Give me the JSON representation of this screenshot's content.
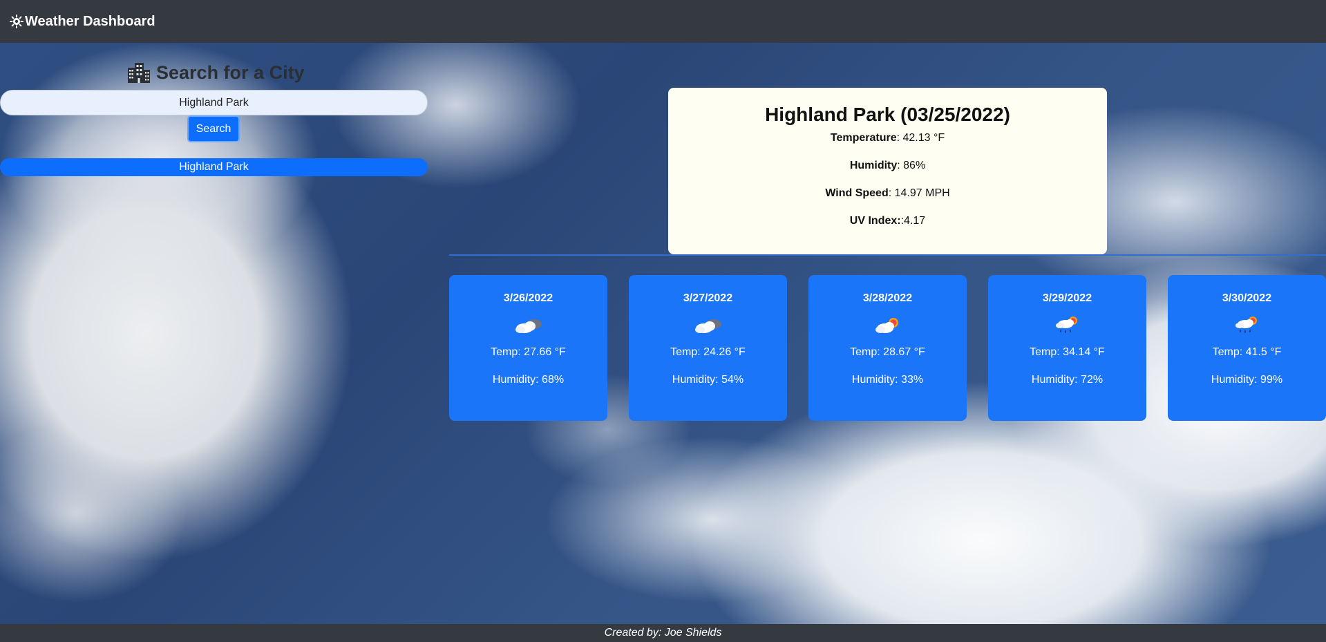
{
  "navbar": {
    "brand_icon": "sun-icon",
    "title": "Weather Dashboard"
  },
  "search": {
    "heading_icon": "city-icon",
    "heading": "Search for a City",
    "input_value": "Highland Park",
    "button_label": "Search",
    "history": [
      "Highland Park"
    ]
  },
  "current": {
    "title": "Highland Park (03/25/2022)",
    "temperature_label": "Temperature",
    "temperature_value": ": 42.13 °F",
    "humidity_label": "Humidity",
    "humidity_value": ": 86%",
    "wind_label": "Wind Speed",
    "wind_value": ": 14.97 MPH",
    "uv_label": "UV Index:",
    "uv_value": ":4.17"
  },
  "forecast": [
    {
      "date": "3/26/2022",
      "icon": "cloudy-night-icon",
      "temp": "Temp: 27.66 °F",
      "humidity": "Humidity: 68%"
    },
    {
      "date": "3/27/2022",
      "icon": "cloudy-night-icon",
      "temp": "Temp: 24.26 °F",
      "humidity": "Humidity: 54%"
    },
    {
      "date": "3/28/2022",
      "icon": "partly-cloudy-icon",
      "temp": "Temp: 28.67 °F",
      "humidity": "Humidity: 33%"
    },
    {
      "date": "3/29/2022",
      "icon": "rain-sun-icon",
      "temp": "Temp: 34.14 °F",
      "humidity": "Humidity: 72%"
    },
    {
      "date": "3/30/2022",
      "icon": "rain-sun-icon",
      "temp": "Temp: 41.5 °F",
      "humidity": "Humidity: 99%"
    }
  ],
  "footer": {
    "text": "Created by: Joe Shields"
  },
  "colors": {
    "navbar": "#343a40",
    "primary": "#0d6efd",
    "forecast_card": "#1a75f9",
    "current_card": "#fefff2"
  }
}
